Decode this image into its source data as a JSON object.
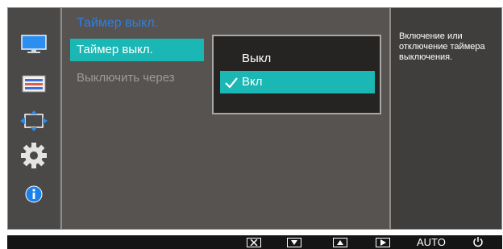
{
  "sidebar": {
    "items": [
      {
        "icon": "monitor-icon"
      },
      {
        "icon": "color-settings-icon"
      },
      {
        "icon": "size-position-icon"
      },
      {
        "icon": "settings-gear-icon"
      },
      {
        "icon": "information-icon"
      }
    ]
  },
  "menu": {
    "title": "Таймер выкл.",
    "items": [
      {
        "label": "Таймер выкл.",
        "state": "selected"
      },
      {
        "label": "Выключить через",
        "state": "disabled"
      }
    ]
  },
  "popup": {
    "options": [
      {
        "label": "Выкл",
        "selected": false
      },
      {
        "label": "Вкл",
        "selected": true
      }
    ]
  },
  "help": {
    "text": "Включение или отключение таймера выключения."
  },
  "bottom_bar": {
    "buttons": [
      {
        "icon": "close-icon"
      },
      {
        "icon": "down-arrow-icon"
      },
      {
        "icon": "up-arrow-icon"
      },
      {
        "icon": "enter-play-icon"
      }
    ],
    "auto_label": "AUTO",
    "power_icon": "power-icon"
  },
  "colors": {
    "accent": "#1ab7b4",
    "title": "#2f7fe0"
  }
}
